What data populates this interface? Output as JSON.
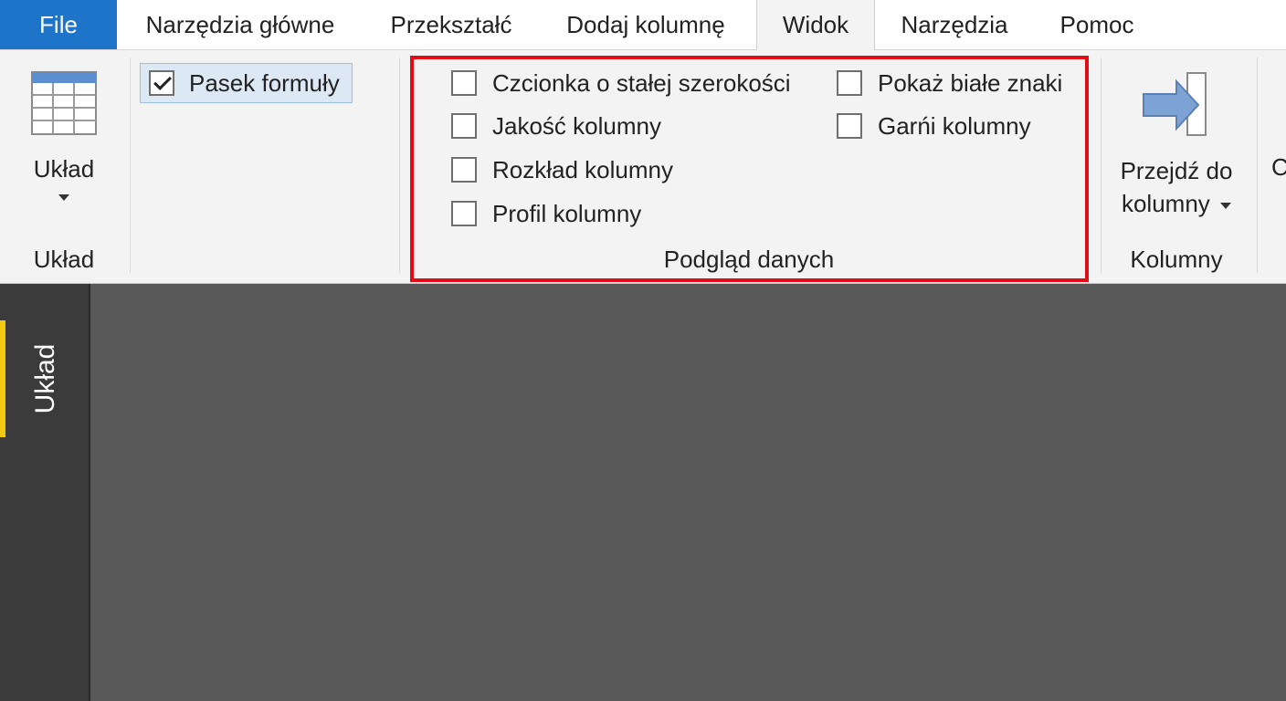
{
  "tabs": [
    {
      "label": "File"
    },
    {
      "label": "Narzędzia główne"
    },
    {
      "label": "Przekształć"
    },
    {
      "label": "Dodaj kolumnę"
    },
    {
      "label": "Widok",
      "active": true
    },
    {
      "label": "Narzędzia"
    },
    {
      "label": "Pomoc"
    }
  ],
  "ribbon": {
    "layout_group": {
      "button_label": "Układ",
      "group_label": "Układ",
      "icon": "table-layout-icon"
    },
    "formula_bar": {
      "label": "Pasek formuły",
      "checked": true
    },
    "data_preview": {
      "group_label": "Podgląd danych",
      "checkboxes": [
        {
          "label": "Czcionka o stałej szerokości",
          "checked": false
        },
        {
          "label": "Jakość kolumny",
          "checked": false
        },
        {
          "label": "Rozkład kolumny",
          "checked": false
        },
        {
          "label": "Profil kolumny",
          "checked": false
        },
        {
          "label": "Pokaż białe znaki",
          "checked": false
        },
        {
          "label": "Garńi kolumny",
          "checked": false
        }
      ]
    },
    "columns_group": {
      "button_label_line1": "Przejdź do",
      "button_label_line2": "kolumny",
      "group_label": "Kolumny",
      "icon": "go-to-column-icon"
    },
    "partial_next": "C"
  },
  "sidebar": {
    "label": "Układ"
  },
  "colors": {
    "file_tab": "#1e74c9",
    "highlight_border": "#e00d16",
    "side_accent": "#f2c811",
    "workspace": "#595959"
  }
}
